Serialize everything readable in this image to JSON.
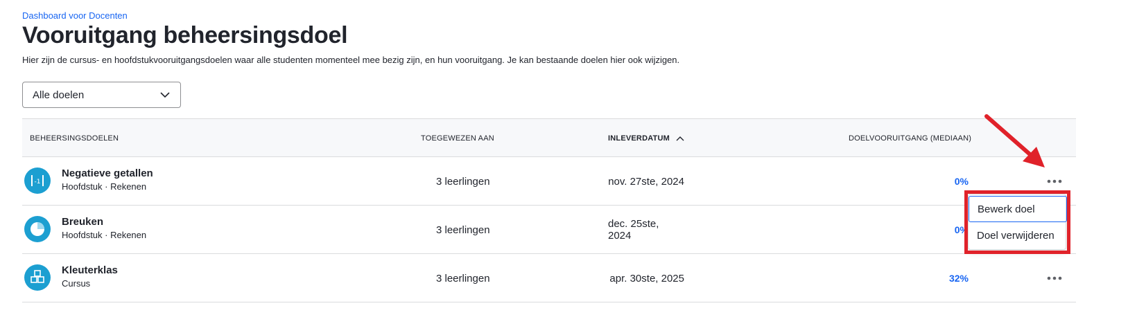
{
  "breadcrumb": "Dashboard voor Docenten",
  "title": "Vooruitgang beheersingsdoel",
  "description": "Hier zijn de cursus- en hoofdstukvooruitgangsdoelen waar alle studenten momenteel mee bezig zijn, en hun vooruitgang. Je kan bestaande doelen hier ook wijzigen.",
  "filter": {
    "value": "Alle doelen",
    "icon": "chevron-down-icon"
  },
  "table": {
    "headers": {
      "goals": "BEHEERSINGSDOELEN",
      "assigned": "TOEGEWEZEN AAN",
      "due": "INLEVERDATUM",
      "progress": "DOELVOORUITGANG (MEDIAAN)"
    },
    "sort": {
      "column": "due",
      "direction": "ascending",
      "icon": "chevron-up-icon"
    },
    "rows": [
      {
        "title": "Negatieve getallen",
        "subtitle": "Hoofdstuk · Rekenen",
        "assigned": "3 leerlingen",
        "due": "nov. 27ste, 2024",
        "progress": "0%",
        "icon": "negative-numbers-icon"
      },
      {
        "title": "Breuken",
        "subtitle": "Hoofdstuk · Rekenen",
        "assigned": "3 leerlingen",
        "due": "dec. 25ste, 2024",
        "progress": "0%",
        "icon": "fractions-icon"
      },
      {
        "title": "Kleuterklas",
        "subtitle": "Cursus",
        "assigned": "3 leerlingen",
        "due": "apr. 30ste, 2025",
        "progress": "32%",
        "icon": "blocks-icon"
      }
    ]
  },
  "context_menu": {
    "items": [
      "Bewerk doel",
      "Doel verwijderen"
    ]
  },
  "icon_label": "-1",
  "colors": {
    "accent": "#1865f2",
    "icon_bg": "#1c9fd1",
    "annotation": "#e0222a"
  }
}
